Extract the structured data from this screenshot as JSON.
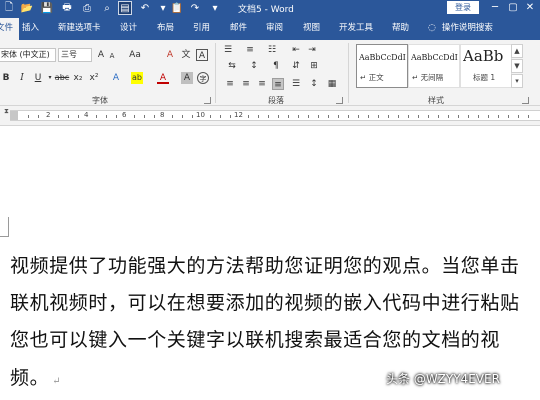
{
  "window": {
    "title": "文档5 - Word",
    "login_label": "登录",
    "min_glyph": "─",
    "restore_glyph": "▢",
    "close_glyph": "✕"
  },
  "quick_access": [
    {
      "icon": "new-doc-icon",
      "glyph": "🗋"
    },
    {
      "icon": "open-folder-icon",
      "glyph": "📂"
    },
    {
      "icon": "save-icon",
      "glyph": "💾"
    },
    {
      "icon": "print-preview-icon",
      "glyph": "🖶"
    },
    {
      "icon": "read-mode-icon",
      "glyph": "▤"
    },
    {
      "icon": "undo-icon",
      "glyph": "↶"
    },
    {
      "icon": "paste-icon",
      "glyph": "📋"
    },
    {
      "icon": "redo-icon",
      "glyph": "↷"
    },
    {
      "icon": "customize-icon",
      "glyph": "▾"
    }
  ],
  "tabs": [
    {
      "label": "文件",
      "active": false
    },
    {
      "label": "插入",
      "active": false
    },
    {
      "label": "新建选项卡",
      "active": false
    },
    {
      "label": "设计",
      "active": false
    },
    {
      "label": "布局",
      "active": false
    },
    {
      "label": "引用",
      "active": false
    },
    {
      "label": "邮件",
      "active": false
    },
    {
      "label": "审阅",
      "active": false
    },
    {
      "label": "视图",
      "active": false
    },
    {
      "label": "开发工具",
      "active": false
    },
    {
      "label": "帮助",
      "active": false
    }
  ],
  "tell_me": {
    "label": "操作说明搜索",
    "icon": "lightbulb-icon"
  },
  "ribbon": {
    "font": {
      "name": "宋体 (中文正)",
      "size": "三号",
      "group_label": "字体",
      "buttons": {
        "grow": "A",
        "shrink": "A",
        "change_case": "Aa",
        "clear_format": "A",
        "phonetic": "文",
        "border": "A",
        "bold": "B",
        "italic": "I",
        "underline": "U",
        "strike": "abc",
        "subscript": "x₂",
        "superscript": "x²",
        "text_effect": "A",
        "highlight": "ab",
        "font_color": "A",
        "shading": "A",
        "enclose": "字"
      }
    },
    "paragraph": {
      "group_label": "段落"
    },
    "styles": {
      "group_label": "样式",
      "items": [
        {
          "sample": "AaBbCcDdI",
          "name": "↵ 正文",
          "selected": true,
          "big": false
        },
        {
          "sample": "AaBbCcDdI",
          "name": "↵ 无间隔",
          "selected": false,
          "big": false
        },
        {
          "sample": "AaBb",
          "name": "标题 1",
          "selected": false,
          "big": true
        }
      ]
    }
  },
  "ruler": {
    "numbers": [
      "2",
      "4",
      "6",
      "8",
      "10",
      "12"
    ]
  },
  "document": {
    "lines": [
      "视频提供了功能强大的方法帮助您证明您的观点。当您单击",
      "联机视频时，可以在想要添加的视频的嵌入代码中进行粘贴",
      "您也可以键入一个关键字以联机搜索最适合您的文档的视",
      "频。"
    ],
    "paragraph_mark": "↵"
  },
  "watermark": "头条 @WZYY4EVER"
}
